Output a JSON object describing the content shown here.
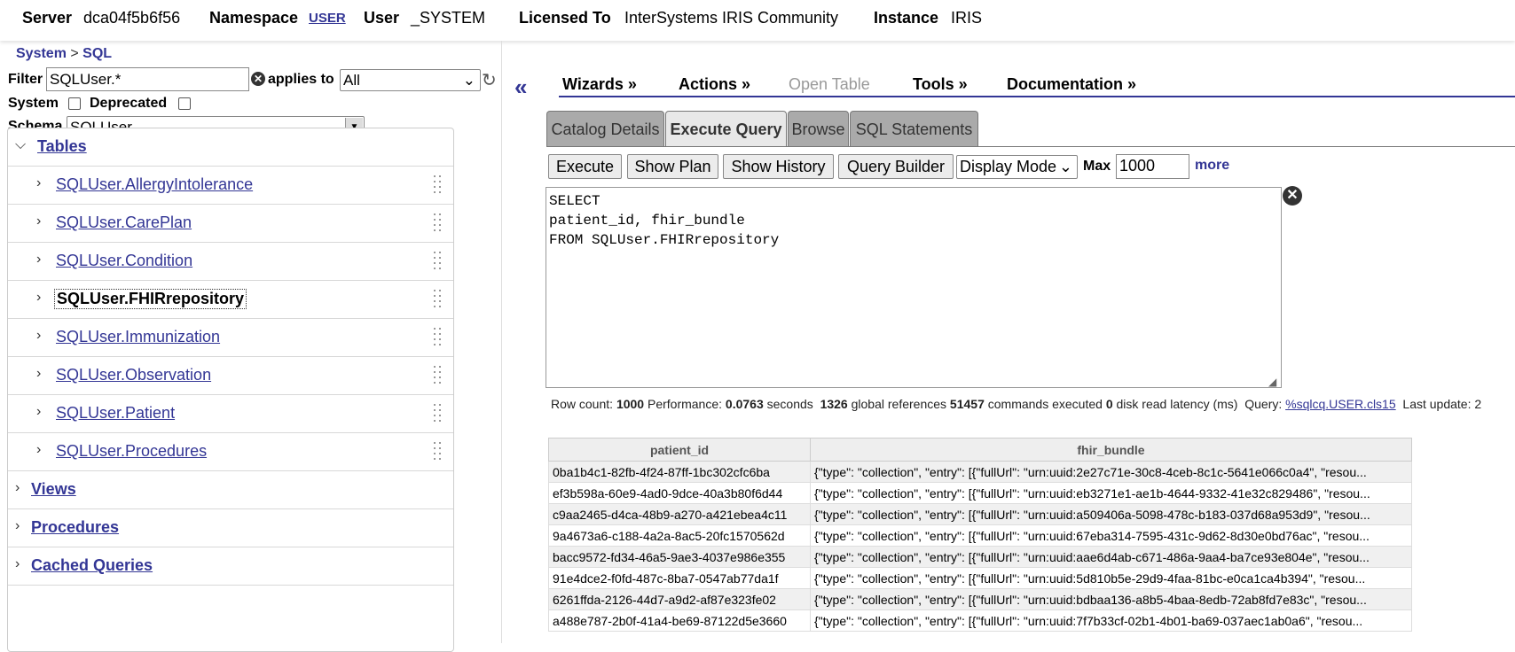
{
  "header": {
    "server_label": "Server",
    "server_value": "dca04f5b6f56",
    "namespace_label": "Namespace",
    "namespace_value": "USER",
    "user_label": "User",
    "user_value": "_SYSTEM",
    "licensed_label": "Licensed To",
    "licensed_value": "InterSystems IRIS Community",
    "instance_label": "Instance",
    "instance_value": "IRIS"
  },
  "breadcrumb": {
    "root": "System",
    "sep": ">",
    "current": "SQL"
  },
  "filters": {
    "filter_label": "Filter",
    "filter_value": "SQLUser.*",
    "applies_label": "applies to",
    "applies_value": "All",
    "system_label": "System",
    "deprecated_label": "Deprecated",
    "schema_label": "Schema",
    "schema_value": "SQLUser"
  },
  "tree": {
    "tables_label": "Tables",
    "tables": [
      "SQLUser.AllergyIntolerance",
      "SQLUser.CarePlan",
      "SQLUser.Condition",
      "SQLUser.FHIRrepository",
      "SQLUser.Immunization",
      "SQLUser.Observation",
      "SQLUser.Patient",
      "SQLUser.Procedures"
    ],
    "views_label": "Views",
    "procedures_label": "Procedures",
    "cached_label": "Cached Queries"
  },
  "menu": {
    "wizards": "Wizards »",
    "actions": "Actions »",
    "open_table": "Open Table",
    "tools": "Tools »",
    "documentation": "Documentation »"
  },
  "tabs": [
    "Catalog Details",
    "Execute Query",
    "Browse",
    "SQL Statements"
  ],
  "toolbar": {
    "execute": "Execute",
    "show_plan": "Show Plan",
    "show_history": "Show History",
    "query_builder": "Query Builder",
    "display_mode": "Display Mode",
    "max_label": "Max",
    "max_value": "1000",
    "more": "more"
  },
  "query_text": "SELECT\npatient_id, fhir_bundle\nFROM SQLUser.FHIRrepository",
  "stats": {
    "row_count_label": "Row count:",
    "row_count": "1000",
    "performance_label": "Performance:",
    "performance": "0.0763",
    "seconds": "seconds",
    "global_refs": "1326",
    "global_refs_label": "global references",
    "commands": "51457",
    "commands_label": "commands executed",
    "disk": "0",
    "disk_label": "disk read latency (ms)",
    "query_label": "Query:",
    "query_link": "%sqlcq.USER.cls15",
    "last_update": "Last update: 2"
  },
  "results": {
    "columns": [
      "patient_id",
      "fhir_bundle"
    ],
    "rows": [
      [
        "0ba1b4c1-82fb-4f24-87ff-1bc302cfc6ba",
        "{\"type\": \"collection\", \"entry\": [{\"fullUrl\": \"urn:uuid:2e27c71e-30c8-4ceb-8c1c-5641e066c0a4\", \"resou..."
      ],
      [
        "ef3b598a-60e9-4ad0-9dce-40a3b80f6d44",
        "{\"type\": \"collection\", \"entry\": [{\"fullUrl\": \"urn:uuid:eb3271e1-ae1b-4644-9332-41e32c829486\", \"resou..."
      ],
      [
        "c9aa2465-d4ca-48b9-a270-a421ebea4c11",
        "{\"type\": \"collection\", \"entry\": [{\"fullUrl\": \"urn:uuid:a509406a-5098-478c-b183-037d68a953d9\", \"resou..."
      ],
      [
        "9a4673a6-c188-4a2a-8ac5-20fc1570562d",
        "{\"type\": \"collection\", \"entry\": [{\"fullUrl\": \"urn:uuid:67eba314-7595-431c-9d62-8d30e0bd76ac\", \"resou..."
      ],
      [
        "bacc9572-fd34-46a5-9ae3-4037e986e355",
        "{\"type\": \"collection\", \"entry\": [{\"fullUrl\": \"urn:uuid:aae6d4ab-c671-486a-9aa4-ba7ce93e804e\", \"resou..."
      ],
      [
        "91e4dce2-f0fd-487c-8ba7-0547ab77da1f",
        "{\"type\": \"collection\", \"entry\": [{\"fullUrl\": \"urn:uuid:5d810b5e-29d9-4faa-81bc-e0ca1ca4b394\", \"resou..."
      ],
      [
        "6261ffda-2126-44d7-a9d2-af87e323fe02",
        "{\"type\": \"collection\", \"entry\": [{\"fullUrl\": \"urn:uuid:bdbaa136-a8b5-4baa-8edb-72ab8fd7e83c\", \"resou..."
      ],
      [
        "a488e787-2b0f-41a4-be69-87122d5e3660",
        "{\"type\": \"collection\", \"entry\": [{\"fullUrl\": \"urn:uuid:7f7b33cf-02b1-4b01-ba69-037aec1ab0a6\", \"resou..."
      ]
    ]
  },
  "colors": {
    "accent": "#333695",
    "tab_inactive": "#aaaaaa",
    "tab_active": "#e8e8e8"
  }
}
